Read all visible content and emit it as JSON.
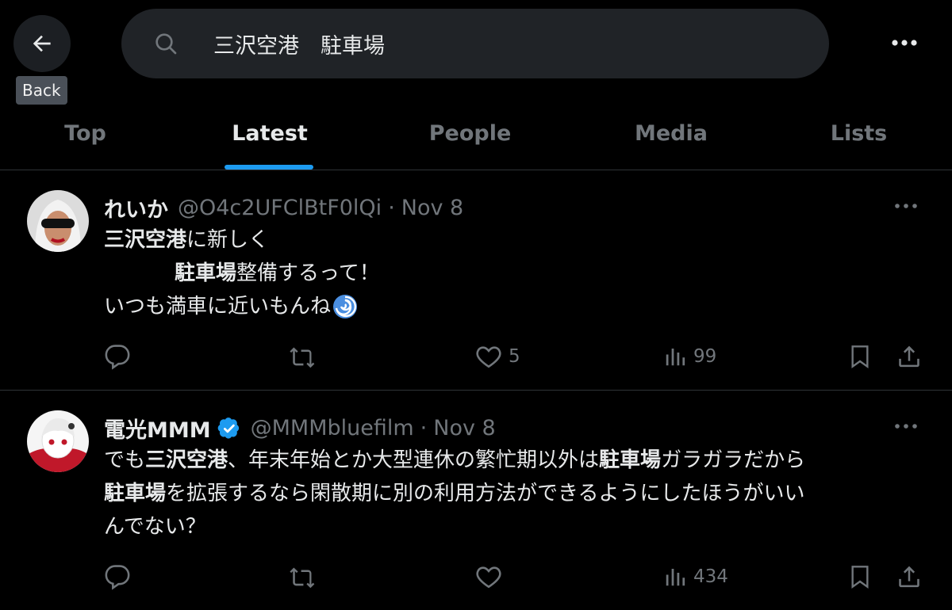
{
  "header": {
    "back_tooltip": "Back",
    "search_value": "三沢空港　駐車場"
  },
  "tabs": [
    {
      "label": "Top"
    },
    {
      "label": "Latest"
    },
    {
      "label": "People"
    },
    {
      "label": "Media"
    },
    {
      "label": "Lists"
    }
  ],
  "active_tab": "Latest",
  "colors": {
    "accent": "#1d9bf0",
    "verified": "#1d9bf0",
    "muted": "#71767b"
  },
  "tweets": [
    {
      "name": "れいか",
      "handle": "@O4c2UFClBtF0lQi",
      "dot": "·",
      "date": "Nov 8",
      "body": {
        "l1_bold": "三沢空港",
        "l1_rest": "に新しく",
        "l2_bold": "駐車場",
        "l2_rest": "整備するって！",
        "l3": "いつも満車に近いもんね",
        "emoji": "cyclone-emoji"
      },
      "likes": "5",
      "views": "99"
    },
    {
      "name": "電光MMM",
      "verified": true,
      "handle": "@MMMbluefilm",
      "dot": "·",
      "date": "Nov 8",
      "body": {
        "p1": "でも",
        "b1": "三沢空港",
        "p2": "、年末年始とか大型連休の繁忙期以外は",
        "b2": "駐車場",
        "p3": "ガラガラだから",
        "b3": "駐車場",
        "p4": "を拡張するなら閑散期に別の利用方法ができるようにしたほうがいい",
        "p5": "んでない？"
      },
      "likes": "",
      "views": "434"
    }
  ]
}
